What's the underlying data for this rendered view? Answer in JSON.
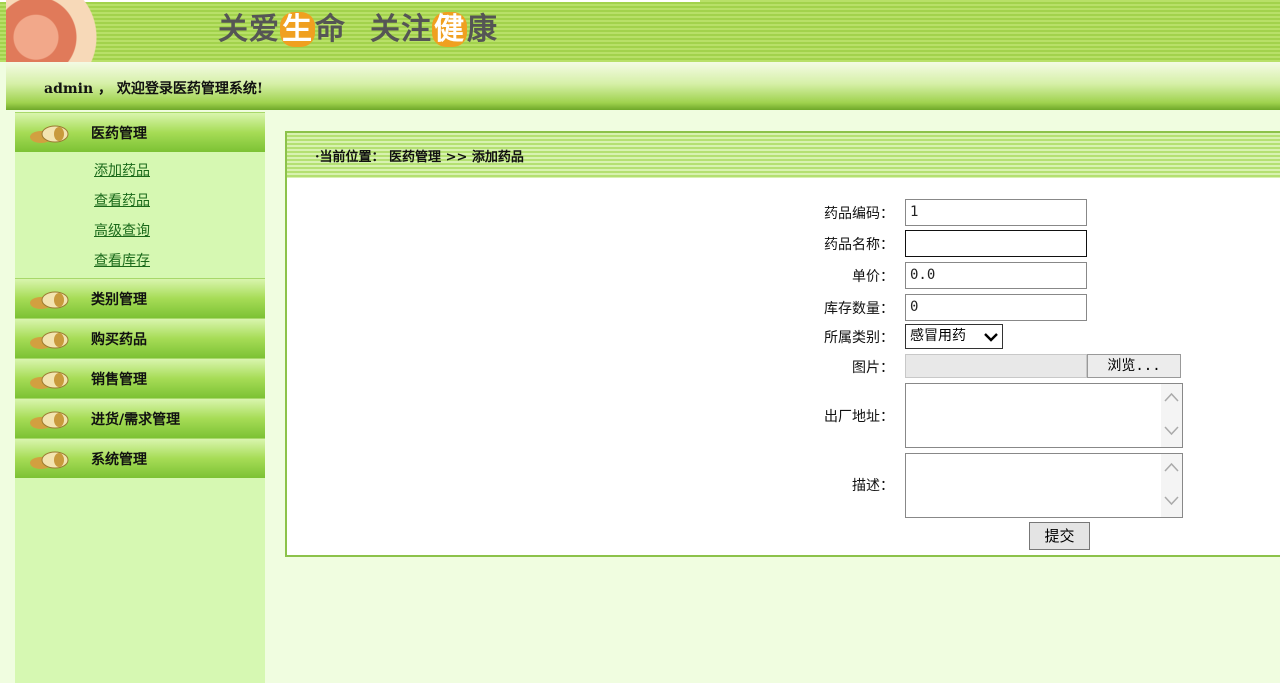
{
  "banner": {
    "slogan_part1": "关爱",
    "slogan_hl1": "生",
    "slogan_part2": "命",
    "slogan_part3": "关注",
    "slogan_hl2": "健",
    "slogan_part4": "康"
  },
  "welcome": {
    "text": "admin ， 欢迎登录医药管理系统!"
  },
  "sidebar": {
    "menus": [
      {
        "label": "医药管理",
        "items": [
          "添加药品",
          "查看药品",
          "高级查询",
          "查看库存"
        ]
      },
      {
        "label": "类别管理"
      },
      {
        "label": "购买药品"
      },
      {
        "label": "销售管理"
      },
      {
        "label": "进货/需求管理"
      },
      {
        "label": "系统管理"
      }
    ]
  },
  "breadcrumb": {
    "text": "·当前位置： 医药管理 >> 添加药品"
  },
  "form": {
    "code_label": "药品编码：",
    "code_value": "1",
    "name_label": "药品名称：",
    "name_value": "",
    "price_label": "单价：",
    "price_value": "0.0",
    "stock_label": "库存数量：",
    "stock_value": "0",
    "category_label": "所属类别：",
    "category_value": "感冒用药",
    "image_label": "图片：",
    "browse_label": "浏览...",
    "factory_label": "出厂地址：",
    "desc_label": "描述：",
    "submit_label": "提交"
  },
  "colors": {
    "green_accent": "#7cc234",
    "panel_border": "#8cc24a",
    "link": "#1a6a1a"
  }
}
